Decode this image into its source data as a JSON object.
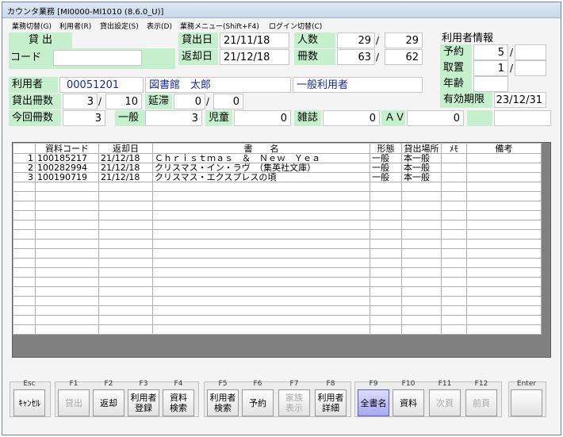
{
  "window": {
    "title": "カウンタ業務 [MI0000-MI1010 (8.6.0_U)]"
  },
  "menu": [
    "業務切替(G)",
    "利用者(R)",
    "貸出設定(S)",
    "表示(D)",
    "業務メニュー(Shift+F4)",
    "ログイン切替(C)"
  ],
  "loan": {
    "mode_label": "貸 出",
    "code_label": "コード",
    "code_value": "",
    "loan_date_label": "貸出日",
    "loan_date": "21/11/18",
    "return_date_label": "返却日",
    "return_date": "21/12/18",
    "people_label": "人数",
    "people_count": "29",
    "people_total": "29",
    "books_label": "冊数",
    "books_count": "63",
    "books_total": "62"
  },
  "user_info": {
    "title": "利用者情報",
    "reserve_label": "予約",
    "reserve_value": "5",
    "pickup_label": "取置",
    "pickup_value": "1",
    "age_label": "年齢",
    "age_value": "",
    "expiry_label": "有効期限",
    "expiry_value": "23/12/31"
  },
  "user": {
    "label": "利用者",
    "id": "00051201",
    "name": "図書館　太郎",
    "type": "一般利用者",
    "loan_count_label": "貸出冊数",
    "loan_count": "3",
    "loan_limit": "10",
    "overdue_label": "延滞",
    "overdue_count": "0",
    "overdue_total": "0",
    "session_label": "今回冊数",
    "session_count": "3",
    "general_label": "一般",
    "general_count": "3",
    "child_label": "児童",
    "child_count": "0",
    "magazine_label": "雑誌",
    "magazine_count": "0",
    "av_label": "ＡＶ",
    "av_count": "0"
  },
  "grid": {
    "headers": [
      "",
      "資料コード",
      "返却日",
      "書　　名",
      "形態",
      "貸出場所",
      "ﾒﾓ",
      "備考"
    ],
    "rows": [
      [
        "1",
        "100185217",
        "21/12/18",
        "Ｃｈｒｉｓｔｍａｓ　＆　Ｎｅｗ　Ｙｅａ",
        "一般",
        "本一般",
        "",
        ""
      ],
      [
        "2",
        "100282994",
        "21/12/18",
        "クリスマス・イン・ラヴ　（集英社文庫）",
        "一般",
        "本一般",
        "",
        ""
      ],
      [
        "3",
        "100190719",
        "21/12/18",
        "クリスマス・エクスプレスの頃",
        "一般",
        "本一般",
        "",
        ""
      ]
    ]
  },
  "fkeys": [
    {
      "key": "Esc",
      "label": "ｷｬﾝｾﾙ"
    },
    {
      "key": "F1",
      "label": "貸出"
    },
    {
      "key": "F2",
      "label": "返却"
    },
    {
      "key": "F3",
      "label": "利用者\n登録"
    },
    {
      "key": "F4",
      "label": "資料\n検索"
    },
    {
      "key": "F5",
      "label": "利用者\n検索"
    },
    {
      "key": "F6",
      "label": "予約"
    },
    {
      "key": "F7",
      "label": "家族\n表示"
    },
    {
      "key": "F8",
      "label": "利用者\n詳細"
    },
    {
      "key": "F9",
      "label": "全書名"
    },
    {
      "key": "F10",
      "label": "資料"
    },
    {
      "key": "F11",
      "label": "次頁"
    },
    {
      "key": "F12",
      "label": "前頁"
    },
    {
      "key": "Enter",
      "label": ""
    }
  ]
}
